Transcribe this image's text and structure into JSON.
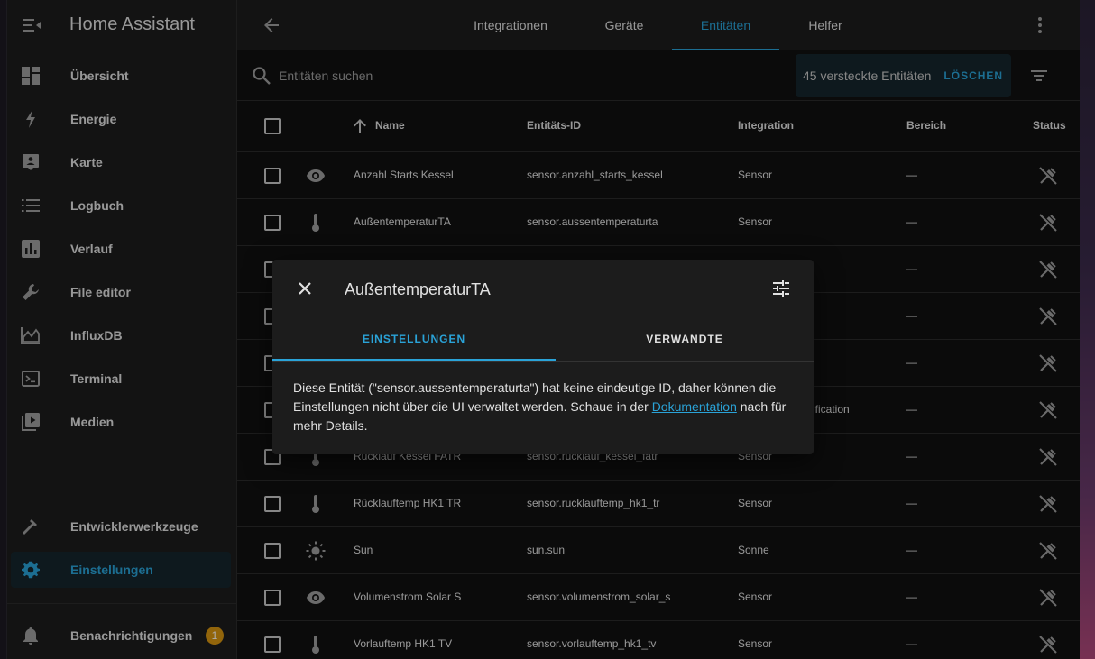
{
  "app": {
    "title": "Home Assistant"
  },
  "sidebar": {
    "items": [
      {
        "label": "Übersicht",
        "icon": "dashboard-icon"
      },
      {
        "label": "Energie",
        "icon": "lightning-icon"
      },
      {
        "label": "Karte",
        "icon": "map-icon"
      },
      {
        "label": "Logbuch",
        "icon": "list-icon"
      },
      {
        "label": "Verlauf",
        "icon": "chart-icon"
      },
      {
        "label": "File editor",
        "icon": "wrench-icon"
      },
      {
        "label": "InfluxDB",
        "icon": "area-chart-icon"
      },
      {
        "label": "Terminal",
        "icon": "console-icon"
      },
      {
        "label": "Medien",
        "icon": "media-icon"
      }
    ],
    "developer_tools": "Entwicklerwerkzeuge",
    "settings": "Einstellungen",
    "notifications": "Benachrichtigungen",
    "notification_count": "1"
  },
  "tabs": [
    {
      "label": "Integrationen"
    },
    {
      "label": "Geräte"
    },
    {
      "label": "Entitäten",
      "active": true
    },
    {
      "label": "Helfer"
    }
  ],
  "search": {
    "placeholder": "Entitäten suchen",
    "hidden_entities": "45 versteckte Entitäten",
    "clear_label": "LÖSCHEN"
  },
  "table": {
    "headers": {
      "name": "Name",
      "entity_id": "Entitäts-ID",
      "integration": "Integration",
      "area": "Bereich",
      "status": "Status"
    },
    "rows": [
      {
        "icon": "eye-icon",
        "name": "Anzahl Starts Kessel",
        "entity_id": "sensor.anzahl_starts_kessel",
        "integration": "Sensor",
        "area": "—"
      },
      {
        "icon": "thermometer-icon",
        "name": "AußentemperaturTA",
        "entity_id": "sensor.aussentemperaturta",
        "integration": "Sensor",
        "area": "—"
      },
      {
        "icon": "",
        "name": "",
        "entity_id": "",
        "integration": "",
        "area": "—"
      },
      {
        "icon": "",
        "name": "",
        "entity_id": "",
        "integration": "",
        "area": "—"
      },
      {
        "icon": "",
        "name": "",
        "entity_id": "",
        "integration": "",
        "area": "—"
      },
      {
        "icon": "",
        "name": "",
        "entity_id": "",
        "integration": "ification",
        "area": "—"
      },
      {
        "icon": "thermometer-icon",
        "name": "Rücklauf Kessel FATR",
        "entity_id": "sensor.rucklauf_kessel_fatr",
        "integration": "Sensor",
        "area": "—"
      },
      {
        "icon": "thermometer-icon",
        "name": "Rücklauftemp HK1 TR",
        "entity_id": "sensor.rucklauftemp_hk1_tr",
        "integration": "Sensor",
        "area": "—"
      },
      {
        "icon": "sun-icon",
        "name": "Sun",
        "entity_id": "sun.sun",
        "integration": "Sonne",
        "area": "—"
      },
      {
        "icon": "eye-icon",
        "name": "Volumenstrom Solar S",
        "entity_id": "sensor.volumenstrom_solar_s",
        "integration": "Sensor",
        "area": "—"
      },
      {
        "icon": "thermometer-icon",
        "name": "Vorlauftemp HK1 TV",
        "entity_id": "sensor.vorlauftemp_hk1_tv",
        "integration": "Sensor",
        "area": "—"
      }
    ]
  },
  "dialog": {
    "title": "AußentemperaturTA",
    "tab_settings": "EINSTELLUNGEN",
    "tab_related": "VERWANDTE",
    "body_part1": "Diese Entität (\"sensor.aussentemperaturta\") hat keine eindeutige ID, daher können die Einstellungen nicht über die UI verwaltet werden. Schaue in der ",
    "body_link": "Dokumentation",
    "body_part2": " nach für mehr Details."
  },
  "colors": {
    "accent": "#2aa3d8",
    "badge": "#d89611",
    "background": "#111111",
    "surface": "#1c1c1c"
  }
}
